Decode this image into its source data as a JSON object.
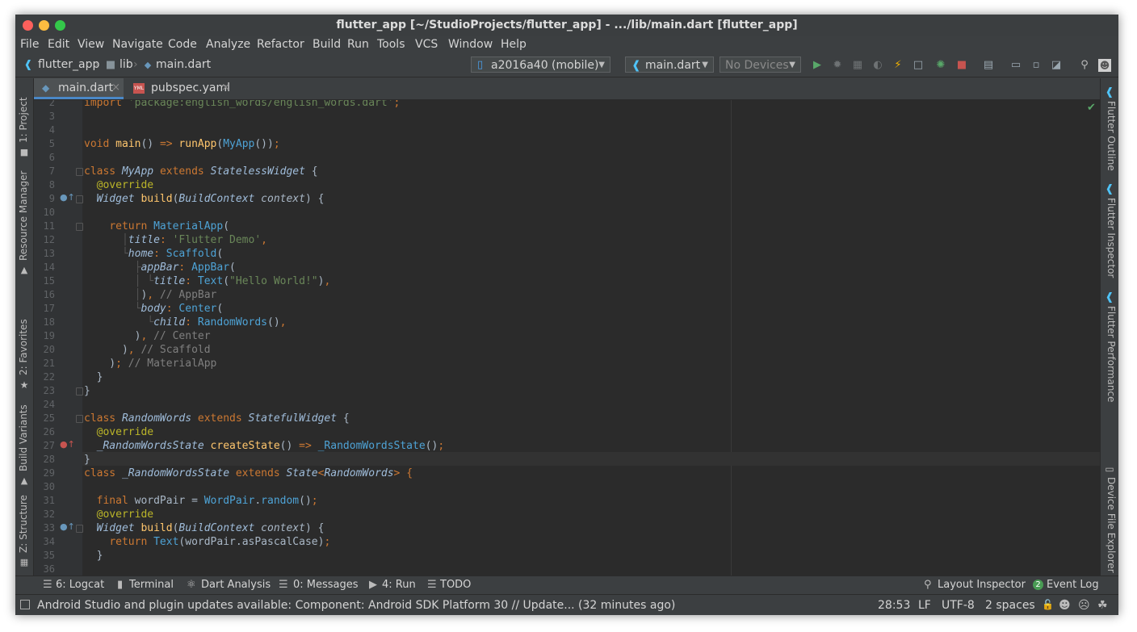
{
  "window_title": "flutter_app [~/StudioProjects/flutter_app] - .../lib/main.dart [flutter_app]",
  "menu": [
    "File",
    "Edit",
    "View",
    "Navigate",
    "Code",
    "Analyze",
    "Refactor",
    "Build",
    "Run",
    "Tools",
    "VCS",
    "Window",
    "Help"
  ],
  "breadcrumb": {
    "project": "flutter_app",
    "folder": "lib",
    "file": "main.dart"
  },
  "device_combo": "a2016a40 (mobile)",
  "run_config_combo": "main.dart",
  "devices_combo": "No Devices",
  "tabs": [
    {
      "label": "main.dart",
      "active": true
    },
    {
      "label": "pubspec.yaml",
      "active": false
    }
  ],
  "left_tool_tabs": [
    "1: Project",
    "Resource Manager",
    "2: Favorites",
    "Build Variants",
    "Z: Structure"
  ],
  "right_tool_tabs": [
    "Flutter Outline",
    "Flutter Inspector",
    "Flutter Performance",
    "Device File Explorer"
  ],
  "line_numbers": [
    "2",
    "3",
    "4",
    "5",
    "6",
    "7",
    "8",
    "9",
    "10",
    "11",
    "12",
    "13",
    "14",
    "15",
    "16",
    "17",
    "18",
    "19",
    "20",
    "21",
    "22",
    "23",
    "24",
    "25",
    "26",
    "27",
    "28",
    "29",
    "30",
    "31",
    "32",
    "33",
    "34",
    "35",
    "36"
  ],
  "current_line": "28",
  "bottom_tools": [
    "6: Logcat",
    "Terminal",
    "Dart Analysis",
    "0: Messages",
    "4: Run",
    "TODO"
  ],
  "bottom_right_tools": [
    "Layout Inspector",
    "Event Log"
  ],
  "event_log_count": "2",
  "status": {
    "message": "Android Studio and plugin updates available: Component: Android SDK Platform 30 // Update... (32 minutes ago)",
    "position": "28:53",
    "line_ending": "LF",
    "encoding": "UTF-8",
    "indent": "2 spaces"
  },
  "colors": {
    "accent": "#4a88c7",
    "keyword": "#cc7832",
    "function": "#ffc66d",
    "string": "#6a8759",
    "comment": "#7f7f7f"
  }
}
